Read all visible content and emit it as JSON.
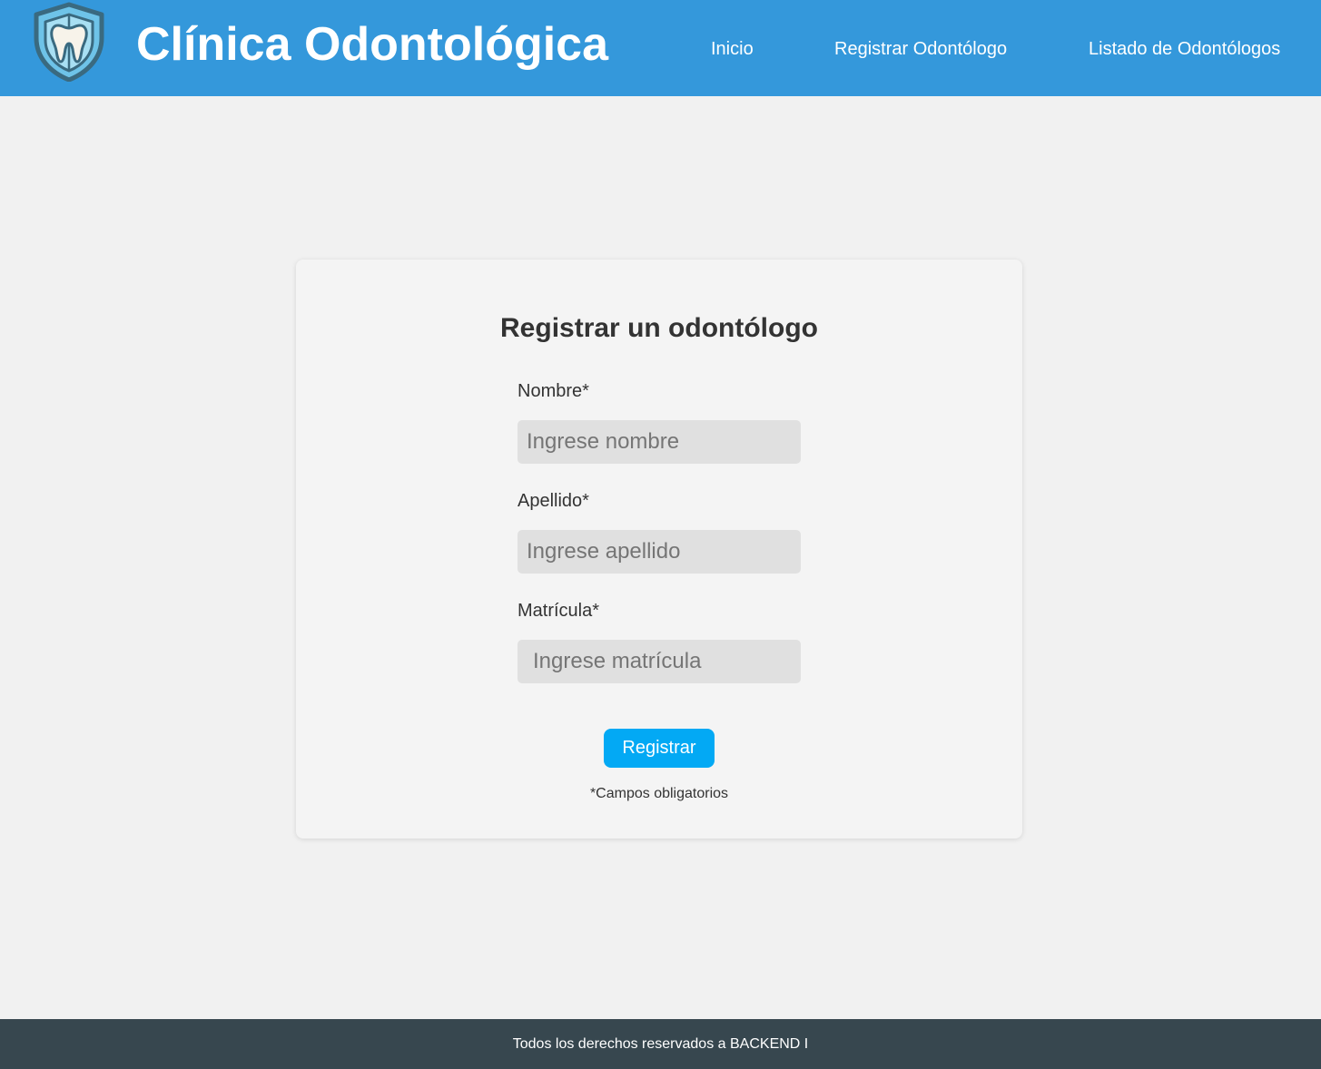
{
  "header": {
    "title": "Clínica Odontológica",
    "logo_icon": "tooth-shield-icon",
    "nav": {
      "home": "Inicio",
      "register": "Registrar Odontólogo",
      "list": "Listado de Odontólogos"
    },
    "background_color": "#3498db"
  },
  "form": {
    "title": "Registrar un odontólogo",
    "fields": {
      "nombre": {
        "label": "Nombre*",
        "placeholder": "Ingrese nombre",
        "value": ""
      },
      "apellido": {
        "label": "Apellido*",
        "placeholder": "Ingrese apellido",
        "value": ""
      },
      "matricula": {
        "label": "Matrícula*",
        "placeholder": "Ingrese matrícula",
        "value": ""
      }
    },
    "submit_label": "Registrar",
    "submit_color": "#03a9f4",
    "required_note": "*Campos obligatorios"
  },
  "footer": {
    "text": "Todos los derechos reservados a BACKEND I",
    "background_color": "#37474f"
  }
}
